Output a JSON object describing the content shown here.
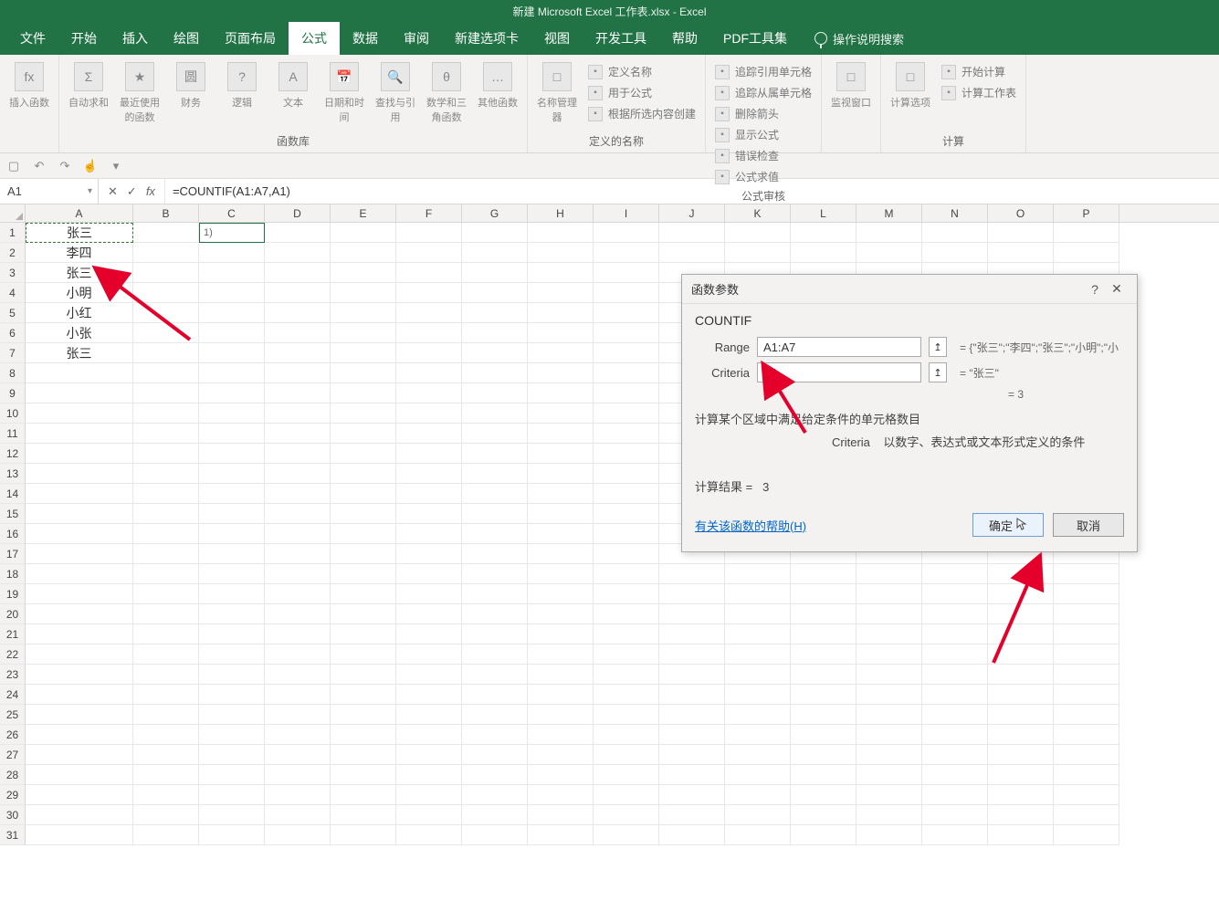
{
  "window": {
    "title": "新建 Microsoft Excel 工作表.xlsx - Excel"
  },
  "tabs": [
    "文件",
    "开始",
    "插入",
    "绘图",
    "页面布局",
    "公式",
    "数据",
    "审阅",
    "新建选项卡",
    "视图",
    "开发工具",
    "帮助",
    "PDF工具集"
  ],
  "active_tab_index": 5,
  "tell_me": "操作说明搜索",
  "ribbon": {
    "groups": [
      {
        "label": "",
        "items": [
          "插入函数"
        ],
        "icons": [
          "fx"
        ]
      },
      {
        "label": "函数库",
        "items": [
          "自动求和",
          "最近使用的函数",
          "财务",
          "逻辑",
          "文本",
          "日期和时间",
          "查找与引用",
          "数学和三角函数",
          "其他函数"
        ],
        "icons": [
          "Σ",
          "★",
          "圆",
          "?",
          "A",
          "📅",
          "🔍",
          "θ",
          "…"
        ]
      },
      {
        "label": "定义的名称",
        "items": [
          "名称管理器"
        ],
        "side_items": [
          "定义名称",
          "用于公式",
          "根据所选内容创建"
        ]
      },
      {
        "label": "公式审核",
        "side_items": [
          "追踪引用单元格",
          "追踪从属单元格",
          "删除箭头",
          "显示公式",
          "错误检查",
          "公式求值"
        ]
      },
      {
        "label": "",
        "items": [
          "监视窗口"
        ]
      },
      {
        "label": "计算",
        "items": [
          "计算选项"
        ],
        "side_items": [
          "开始计算",
          "计算工作表"
        ]
      }
    ]
  },
  "namebox": "A1",
  "formula": "=COUNTIF(A1:A7,A1)",
  "columns": [
    "A",
    "B",
    "C",
    "D",
    "E",
    "F",
    "G",
    "H",
    "I",
    "J",
    "K",
    "L",
    "M",
    "N",
    "O",
    "P"
  ],
  "row_count": 31,
  "cells": {
    "A1": "张三",
    "A2": "李四",
    "A3": "张三",
    "A4": "小明",
    "A5": "小红",
    "A6": "小张",
    "A7": "张三",
    "C1": "1)"
  },
  "dialog": {
    "title": "函数参数",
    "fn_name": "COUNTIF",
    "range_label": "Range",
    "range_value": "A1:A7",
    "range_result": "= {\"张三\";\"李四\";\"张三\";\"小明\";\"小",
    "criteria_label": "Criteria",
    "criteria_value": "A1",
    "criteria_result": "= \"张三\"",
    "eq_result": "= 3",
    "desc": "计算某个区域中满足给定条件的单元格数目",
    "sub_desc_label": "Criteria",
    "sub_desc": "以数字、表达式或文本形式定义的条件",
    "calc_result_label": "计算结果 =",
    "calc_result_value": "3",
    "help_link": "有关该函数的帮助(H)",
    "ok": "确定",
    "cancel": "取消"
  }
}
